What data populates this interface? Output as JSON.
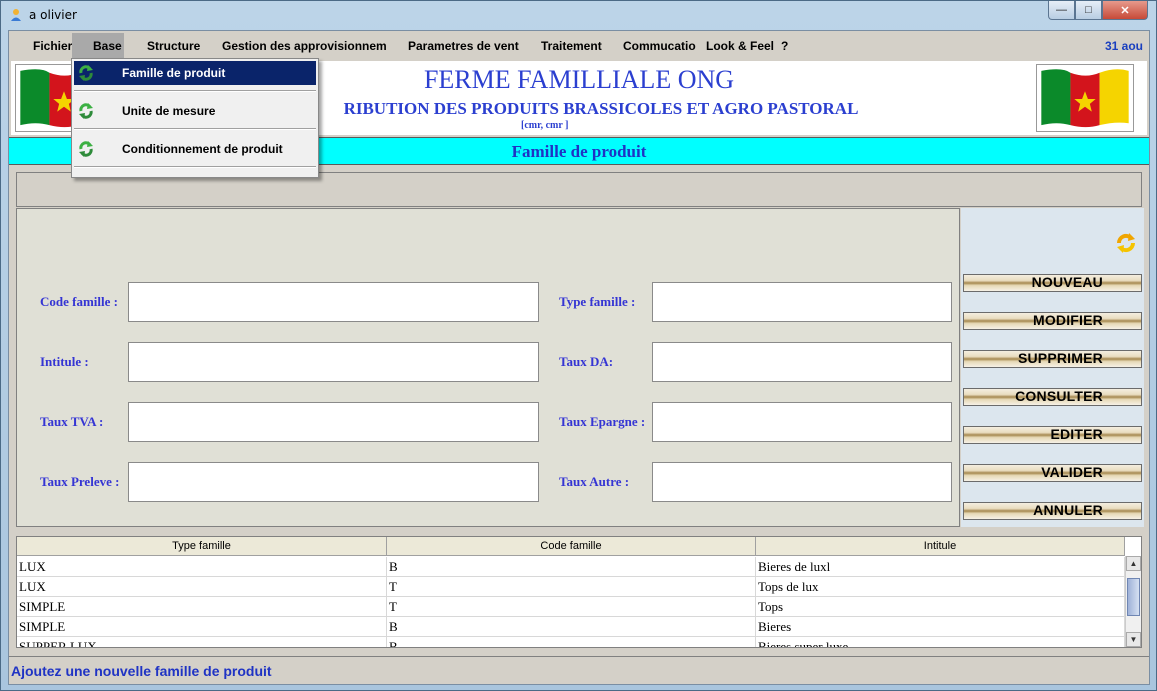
{
  "window": {
    "title": "a olivier",
    "min_glyph": "—",
    "max_glyph": "□",
    "close_glyph": "✕"
  },
  "menubar": {
    "items": [
      "Fichier",
      "Base",
      "Structure",
      "Gestion des approvisionneme",
      "Parametres de vent",
      "Traitement",
      "Commucatio",
      "Look & Feel",
      "?"
    ],
    "date": "31 aou"
  },
  "dropdown": {
    "items": [
      "Famille de produit",
      "Unite de mesure",
      "Conditionnement de produit"
    ],
    "icon": "refresh-green-icon"
  },
  "header": {
    "title": "FERME FAMILLIALE ONG",
    "subtitle": "RIBUTION DES PRODUITS BRASSICOLES ET AGRO PASTORAL",
    "address": "[cmr, cmr                  ]"
  },
  "section": {
    "title": "Famille de produit"
  },
  "form": {
    "code_famille": "Code famille :",
    "intitule": "Intitule :",
    "taux_tva": "Taux TVA :",
    "taux_preleve": "Taux Preleve :",
    "type_famille": "Type famille :",
    "taux_da": "Taux DA:",
    "taux_epargne": "Taux Epargne :",
    "taux_autre": "Taux Autre :"
  },
  "actions": [
    "NOUVEAU",
    "MODIFIER",
    "SUPPRIMER",
    "CONSULTER",
    "EDITER",
    "VALIDER",
    "ANNULER"
  ],
  "grid": {
    "columns": [
      "Type famille",
      "Code famille",
      "Intitule"
    ],
    "rows": [
      [
        "LUX",
        "B",
        "Bieres de luxl"
      ],
      [
        "LUX",
        "T",
        "Tops de lux"
      ],
      [
        "SIMPLE",
        "T",
        "Tops"
      ],
      [
        "SIMPLE",
        "B",
        "Bieres"
      ],
      [
        "SUPPER LUX",
        "B",
        "Bieres super luxe"
      ]
    ]
  },
  "status": {
    "text": "Ajoutez une nouvelle famille de produit"
  },
  "colors": {
    "accent": "#2b3fd0",
    "section_bg": "#00ffff",
    "menu_selected": "#0a246a"
  }
}
